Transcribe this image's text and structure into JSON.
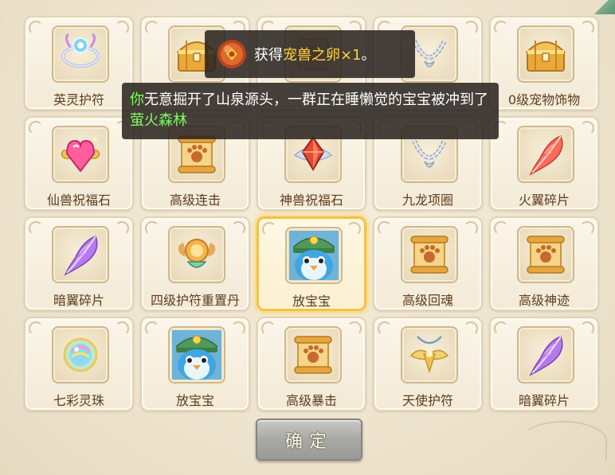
{
  "items": [
    {
      "label": "英灵护符",
      "icon": "amulet-icon"
    },
    {
      "label": "",
      "icon": "treasure-chest-icon"
    },
    {
      "label": "",
      "icon": "item-icon"
    },
    {
      "label": "",
      "icon": "silver-necklace-icon"
    },
    {
      "label": "0级宠物饰物",
      "icon": "treasure-chest-icon"
    },
    {
      "label": "仙兽祝福石",
      "icon": "pink-gem-icon"
    },
    {
      "label": "高级连击",
      "icon": "paw-scroll-icon"
    },
    {
      "label": "神兽祝福石",
      "icon": "red-gem-icon"
    },
    {
      "label": "九龙项圈",
      "icon": "silver-necklace-icon"
    },
    {
      "label": "火翼碎片",
      "icon": "red-feather-icon"
    },
    {
      "label": "暗翼碎片",
      "icon": "purple-feather-icon"
    },
    {
      "label": "四级护符重置丹",
      "icon": "golden-orb-icon"
    },
    {
      "label": "放宝宝",
      "icon": "penguin-pet-icon"
    },
    {
      "label": "高级回魂",
      "icon": "paw-scroll-icon"
    },
    {
      "label": "高级神迹",
      "icon": "paw-scroll-icon"
    },
    {
      "label": "七彩灵珠",
      "icon": "rainbow-orb-icon"
    },
    {
      "label": "放宝宝",
      "icon": "penguin-pet-icon"
    },
    {
      "label": "高级暴击",
      "icon": "paw-scroll-icon"
    },
    {
      "label": "天使护符",
      "icon": "angel-amulet-icon"
    },
    {
      "label": "暗翼碎片",
      "icon": "purple-feather-icon"
    }
  ],
  "selected_index": 12,
  "toast": {
    "prefix": "获得",
    "item": "宠兽之卵",
    "count": "×1",
    "suffix": "。",
    "icon": "pet-egg-icon"
  },
  "message": {
    "part1": "你",
    "part2": "无意掘开了山泉源头，一群正在睡懒觉的宝宝被冲到了",
    "part3": "萤火森林"
  },
  "confirm_label": "确定",
  "colors": {
    "item_name": "#5c3d21",
    "highlight_yellow": "#ffd23f",
    "highlight_green": "#7dff5e",
    "selected_border": "#f2c24a"
  }
}
